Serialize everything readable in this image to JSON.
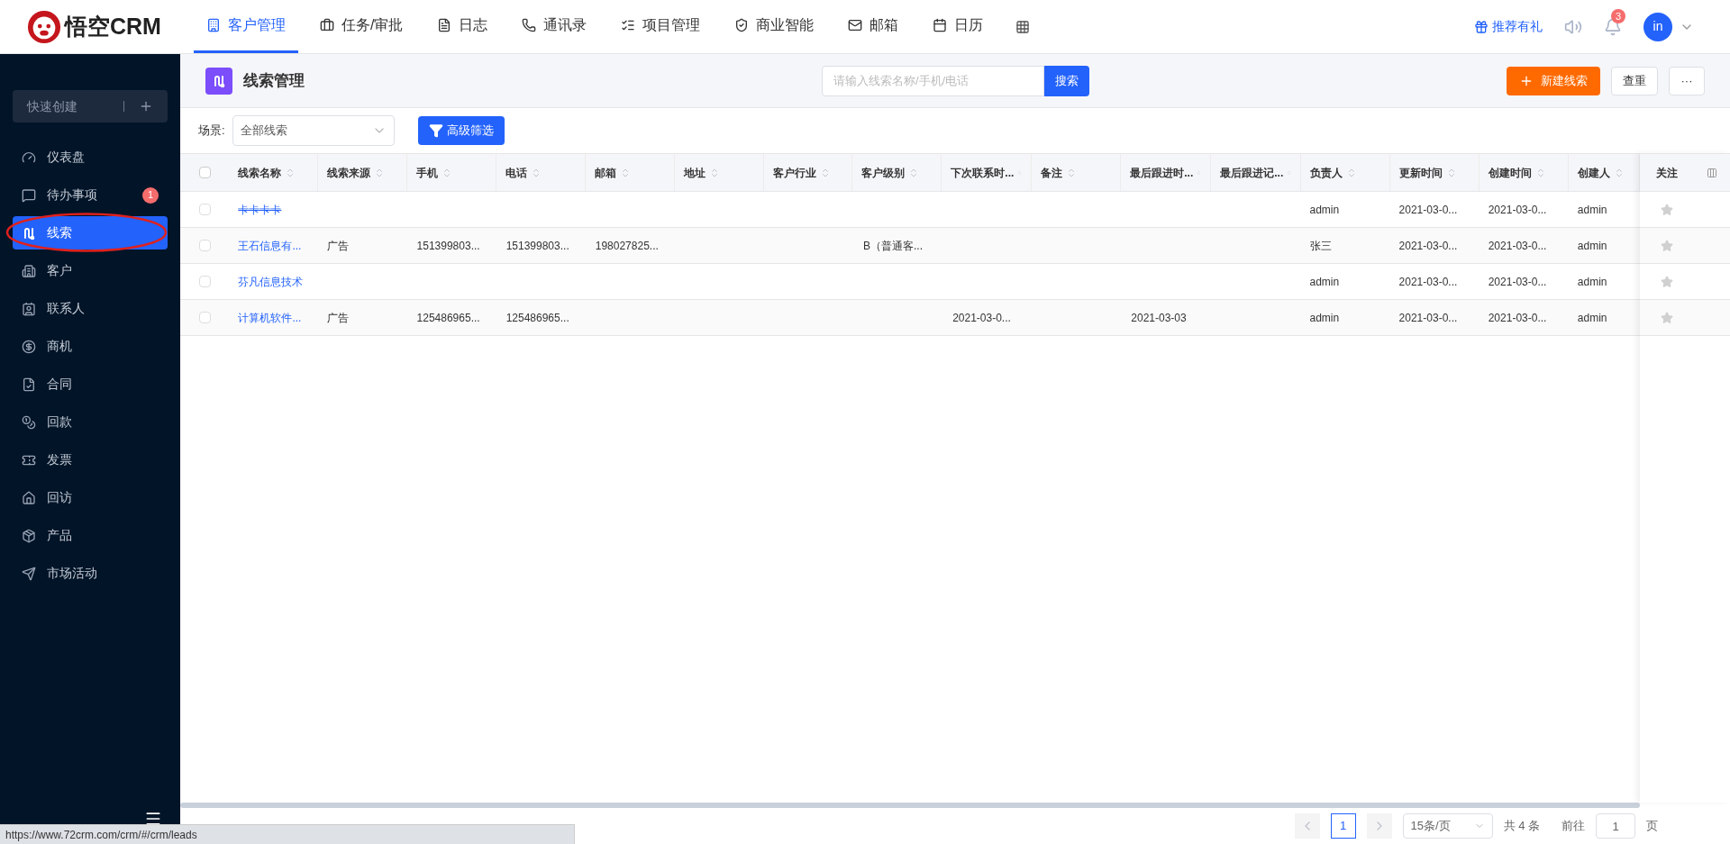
{
  "logo": {
    "text": "悟空CRM"
  },
  "top_nav": [
    {
      "label": "客户管理",
      "selected": true
    },
    {
      "label": "任务/审批",
      "selected": false
    },
    {
      "label": "日志",
      "selected": false
    },
    {
      "label": "通讯录",
      "selected": false
    },
    {
      "label": "项目管理",
      "selected": false
    },
    {
      "label": "商业智能",
      "selected": false
    },
    {
      "label": "邮箱",
      "selected": false
    },
    {
      "label": "日历",
      "selected": false
    }
  ],
  "header_right": {
    "referral": "推荐有礼",
    "notifications": "3",
    "avatar": "in"
  },
  "sidebar": {
    "quick_create": "快速创建",
    "items": [
      {
        "label": "仪表盘",
        "selected": false
      },
      {
        "label": "待办事项",
        "selected": false,
        "badge": "1"
      },
      {
        "label": "线索",
        "selected": true
      },
      {
        "label": "客户",
        "selected": false
      },
      {
        "label": "联系人",
        "selected": false
      },
      {
        "label": "商机",
        "selected": false
      },
      {
        "label": "合同",
        "selected": false
      },
      {
        "label": "回款",
        "selected": false
      },
      {
        "label": "发票",
        "selected": false
      },
      {
        "label": "回访",
        "selected": false
      },
      {
        "label": "产品",
        "selected": false
      },
      {
        "label": "市场活动",
        "selected": false
      }
    ]
  },
  "annotation": {
    "kind": "ellipse",
    "color": "#e0201c"
  },
  "page": {
    "title": "线索管理",
    "search_placeholder": "请输入线索名称/手机/电话",
    "search_button": "搜索",
    "new_button": "新建线索",
    "recheck_button": "查重",
    "more_button": "···"
  },
  "filter": {
    "label": "场景:",
    "scene": "全部线索",
    "advanced": "高级筛选"
  },
  "table": {
    "select_all_checked": false,
    "columns": [
      "线索名称",
      "线索来源",
      "手机",
      "电话",
      "邮箱",
      "地址",
      "客户行业",
      "客户级别",
      "下次联系时...",
      "备注",
      "最后跟进时...",
      "最后跟进记...",
      "负责人",
      "更新时间",
      "创建时间",
      "创建人",
      "关注"
    ],
    "rows": [
      {
        "checked": false,
        "struck": true,
        "cells": {
          "0": "卡卡卡卡",
          "12": "admin",
          "13": "2021-03-0...",
          "14": "2021-03-0...",
          "15": "admin"
        },
        "starred": false
      },
      {
        "checked": false,
        "struck": false,
        "cells": {
          "0": "王石信息有...",
          "1": "广告",
          "2": "151399803...",
          "3": "151399803...",
          "4": "198027825...",
          "7": "B（普通客...",
          "12": "张三",
          "13": "2021-03-0...",
          "14": "2021-03-0...",
          "15": "admin"
        },
        "starred": false
      },
      {
        "checked": false,
        "struck": false,
        "cells": {
          "0": "芬凡信息技术",
          "12": "admin",
          "13": "2021-03-0...",
          "14": "2021-03-0...",
          "15": "admin"
        },
        "starred": false
      },
      {
        "checked": false,
        "struck": false,
        "cells": {
          "0": "计算机软件...",
          "1": "广告",
          "2": "125486965...",
          "3": "125486965...",
          "8": "2021-03-0...",
          "10": "2021-03-03",
          "12": "admin",
          "13": "2021-03-0...",
          "14": "2021-03-0...",
          "15": "admin"
        },
        "starred": false
      }
    ]
  },
  "pagination": {
    "pages": [
      {
        "label": "1",
        "selected": true
      }
    ],
    "page_size": "15条/页",
    "total": "共 4 条",
    "goto_label": "前往",
    "goto_value": "1",
    "page_unit": "页"
  },
  "status_url": "https://www.72crm.com/crm/#/crm/leads"
}
